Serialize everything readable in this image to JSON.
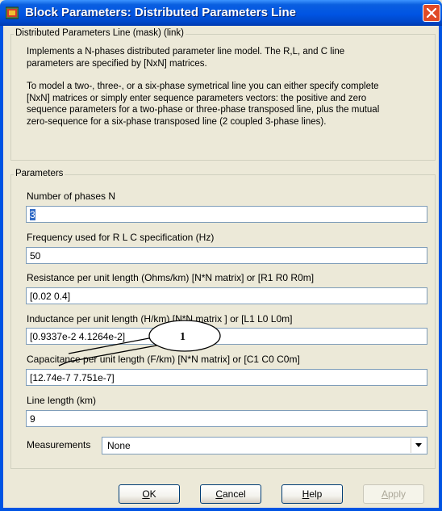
{
  "window": {
    "title": "Block Parameters: Distributed Parameters Line"
  },
  "mask_group": {
    "legend": "Distributed Parameters Line (mask) (link)",
    "description_lines": [
      "Implements a N-phases distributed parameter line model. The R,L, and C line",
      "parameters are specified by [NxN] matrices.",
      "",
      "To model a two-, three-, or a six-phase symetrical line you can either specify complete",
      "[NxN] matrices or simply enter sequence parameters vectors: the  positive and zero",
      "sequence parameters for a two-phase or  three-phase transposed  line, plus the mutual",
      "zero-sequence for a  six-phase transposed  line  (2 coupled 3-phase lines)."
    ]
  },
  "params_group": {
    "legend": "Parameters",
    "fields": [
      {
        "label": "Number of phases N",
        "value": "3"
      },
      {
        "label": "Frequency used for R L C specification (Hz)",
        "value": "50"
      },
      {
        "label": "Resistance per unit length (Ohms/km)   [N*N matrix] or [R1 R0 R0m]",
        "value": "[0.02  0.4]"
      },
      {
        "label": "Inductance per unit length (H/km) [N*N matrix ] or [L1 L0 L0m]",
        "value": "[0.9337e-2  4.1264e-2]"
      },
      {
        "label": "Capacitance per unit length (F/km) [N*N matrix] or [C1 C0 C0m]",
        "value": "[12.74e-7 7.751e-7]"
      },
      {
        "label": "Line length (km)",
        "value": "9"
      }
    ],
    "measurements": {
      "label": "Measurements",
      "value": "None"
    }
  },
  "buttons": {
    "ok": {
      "accel": "O",
      "rest": "K"
    },
    "cancel": {
      "accel": "C",
      "rest": "ancel"
    },
    "help": {
      "accel": "H",
      "rest": "elp"
    },
    "apply": {
      "accel": "A",
      "rest": "pply"
    }
  },
  "callout": {
    "number": "1"
  },
  "colors": {
    "titlebar": "#0054e3",
    "face": "#ece9d8",
    "close": "#e04a26",
    "field_border": "#7f9db9"
  },
  "icons": [
    "simulink-block-icon",
    "close-icon",
    "dropdown-arrow-icon"
  ]
}
